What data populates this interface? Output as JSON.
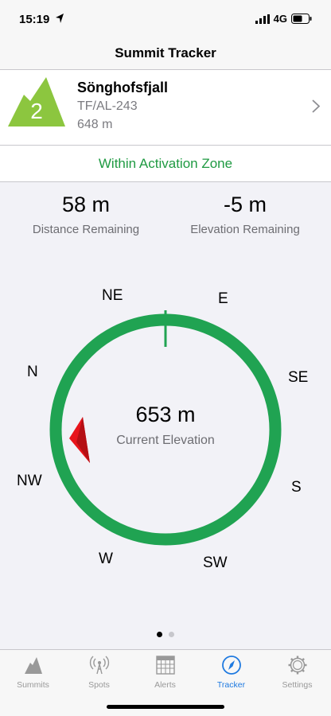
{
  "status": {
    "time": "15:19",
    "network": "4G"
  },
  "nav": {
    "title": "Summit Tracker"
  },
  "summit": {
    "badge_number": "2",
    "name": "Sönghofsfjall",
    "reference": "TF/AL-243",
    "altitude": "648 m",
    "badge_color": "#8cc63f"
  },
  "zone": {
    "text": "Within Activation Zone",
    "color": "#1f9a42"
  },
  "stats": {
    "distance_value": "58 m",
    "distance_label": "Distance Remaining",
    "elevation_value": "-5 m",
    "elevation_label": "Elevation Remaining"
  },
  "compass": {
    "directions": {
      "ne": "NE",
      "e": "E",
      "n": "N",
      "se": "SE",
      "nw": "NW",
      "s": "S",
      "w": "W",
      "sw": "SW"
    },
    "current_elevation_value": "653 m",
    "current_elevation_label": "Current Elevation",
    "ring_color": "#20a352",
    "pointer_color": "#e8141b"
  },
  "pager": {
    "count": 2,
    "active": 1
  },
  "tabs": [
    {
      "label": "Summits",
      "icon": "mountain-icon"
    },
    {
      "label": "Spots",
      "icon": "antenna-icon"
    },
    {
      "label": "Alerts",
      "icon": "calendar-grid-icon"
    },
    {
      "label": "Tracker",
      "icon": "compass-icon"
    },
    {
      "label": "Settings",
      "icon": "gear-icon"
    }
  ],
  "active_tab": "Tracker"
}
